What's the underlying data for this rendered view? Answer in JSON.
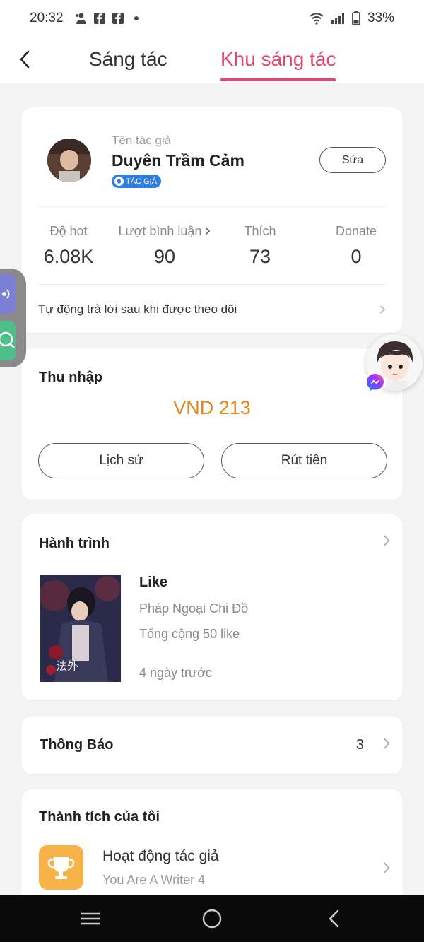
{
  "status_bar": {
    "time": "20:32",
    "battery": "33%"
  },
  "header": {
    "tabs": [
      {
        "label": "Sáng tác",
        "active": false
      },
      {
        "label": "Khu sáng tác",
        "active": true
      }
    ],
    "accent_color": "#e8456e"
  },
  "profile": {
    "author_label": "Tên tác giả",
    "author_name": "Duyên Trầm Cảm",
    "badge": "TÁC GIẢ",
    "edit_label": "Sửa",
    "stats": [
      {
        "label": "Độ hot",
        "value": "6.08K"
      },
      {
        "label": "Lượt bình luận",
        "value": "90"
      },
      {
        "label": "Thích",
        "value": "73"
      },
      {
        "label": "Donate",
        "value": "0"
      }
    ],
    "auto_reply": "Tự động trả lời sau khi được theo dõi"
  },
  "income": {
    "title": "Thu nhập",
    "amount": "VND 213",
    "history_label": "Lịch sử",
    "withdraw_label": "Rút tiền",
    "amount_color": "#e8861d"
  },
  "journey": {
    "title": "Hành trình",
    "entry": {
      "type": "Like",
      "book": "Pháp Ngoại Chi Đồ",
      "total": "Tổng cộng 50 like",
      "time": "4 ngày trước"
    }
  },
  "notice": {
    "title": "Thông Báo",
    "count": "3"
  },
  "achievements": {
    "title": "Thành tích của tôi",
    "item": {
      "name": "Hoạt động tác giả",
      "sub": "You Are A Writer 4"
    }
  }
}
